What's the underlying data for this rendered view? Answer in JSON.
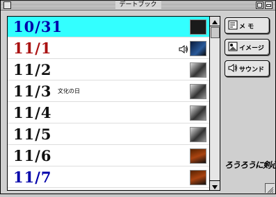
{
  "window": {
    "title": "デートブック"
  },
  "rows": [
    {
      "date": "10/31",
      "color": "#0000aa",
      "note": "",
      "selected": true,
      "sound": false,
      "thumb": "dark"
    },
    {
      "date": "11/1",
      "color": "#aa1111",
      "note": "",
      "selected": false,
      "sound": true,
      "thumb": "blue"
    },
    {
      "date": "11/2",
      "color": "#111111",
      "note": "",
      "selected": false,
      "sound": false,
      "thumb": "light"
    },
    {
      "date": "11/3",
      "color": "#111111",
      "note": "文化の日",
      "selected": false,
      "sound": false,
      "thumb": "light"
    },
    {
      "date": "11/4",
      "color": "#111111",
      "note": "",
      "selected": false,
      "sound": false,
      "thumb": "light"
    },
    {
      "date": "11/5",
      "color": "#111111",
      "note": "",
      "selected": false,
      "sound": false,
      "thumb": "light"
    },
    {
      "date": "11/6",
      "color": "#111111",
      "note": "",
      "selected": false,
      "sound": false,
      "thumb": "fire"
    },
    {
      "date": "11/7",
      "color": "#0000aa",
      "note": "",
      "selected": false,
      "sound": false,
      "thumb": "fire"
    }
  ],
  "buttons": {
    "memo": "メ モ",
    "image": "イメージ",
    "sound": "サウンド"
  },
  "logo": "ろうろうに剣心"
}
